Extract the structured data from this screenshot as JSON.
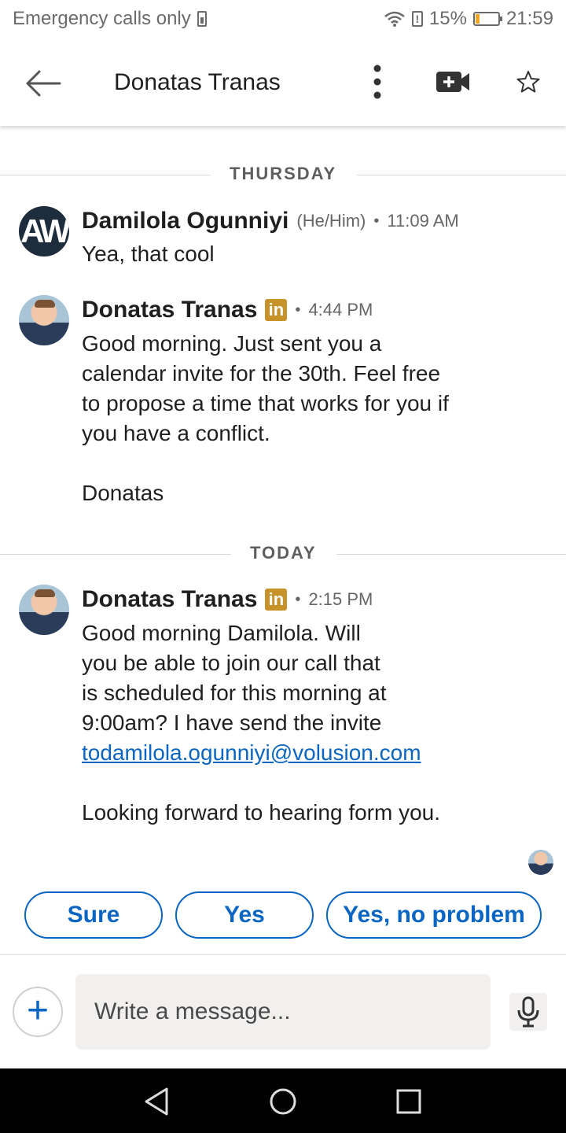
{
  "status_bar": {
    "carrier": "Emergency calls only",
    "battery_percent": "15%",
    "clock": "21:59"
  },
  "header": {
    "title": "Donatas Tranas",
    "icons": [
      "back-arrow-icon",
      "more-vert-icon",
      "video-call-icon",
      "star-icon"
    ]
  },
  "conversation": {
    "dividers": [
      "THURSDAY",
      "TODAY"
    ],
    "messages": [
      {
        "sender": "Damilola Ogunniyi",
        "pronouns": "(He/Him)",
        "time": "11:09 AM",
        "avatar_initials": "AW",
        "lines": [
          "Yea, that cool"
        ]
      },
      {
        "sender": "Donatas Tranas",
        "badge": "in",
        "time": "4:44 PM",
        "lines": [
          "Good morning. Just sent you a",
          "calendar invite for the 30th. Feel free",
          "to propose a time that works for you if",
          "you have a conflict.",
          "Donatas"
        ]
      },
      {
        "sender": "Donatas Tranas",
        "badge": "in",
        "time": "2:15 PM",
        "lines": [
          "Good morning Damilola. Will",
          "you be able to join our call that",
          "is scheduled for this morning at",
          "9:00am? I have send the invite"
        ],
        "link": "todamilola.ogunniyi@volusion.com",
        "closing": "Looking forward to hearing form you."
      }
    ]
  },
  "quick_replies": [
    "Sure",
    "Yes",
    "Yes, no problem"
  ],
  "composer": {
    "placeholder": "Write a message..."
  }
}
